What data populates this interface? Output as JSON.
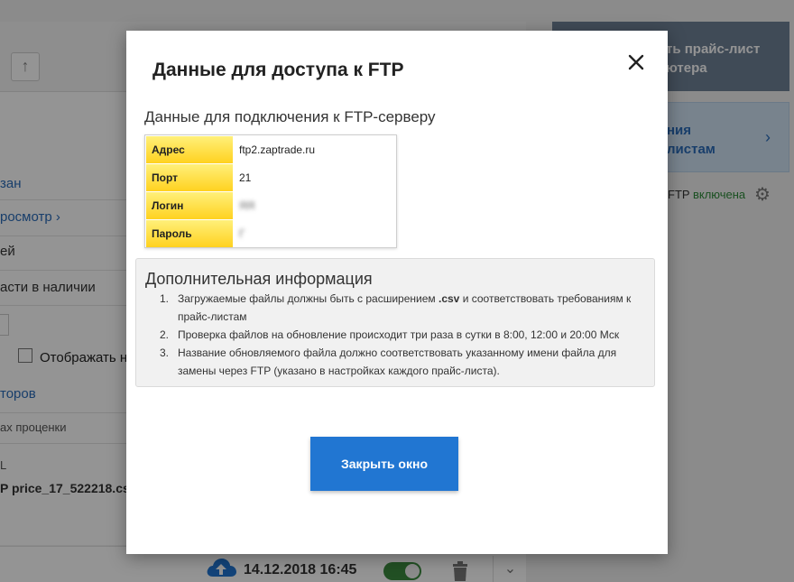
{
  "background": {
    "left_rows": [
      {
        "text": "зан",
        "style": "link"
      },
      {
        "text": "росмотр ›",
        "style": "link"
      },
      {
        "text": "ей",
        "style": "normal"
      },
      {
        "text": "асти в наличии",
        "style": "normal"
      }
    ],
    "checkbox_label": "Отображать н",
    "rows_bottom": [
      {
        "text": "торов",
        "style": "link"
      },
      {
        "text": "ах проценки",
        "style": "small"
      },
      {
        "text": "L",
        "style": "small"
      },
      {
        "text": "P price_17_522218.cs",
        "style": "bold"
      }
    ],
    "right_card1_text": [
      "ть прайс-лист",
      "ютера"
    ],
    "right_card2_text": [
      "ния",
      "листам"
    ],
    "ftp_status_prefix": "FTP",
    "ftp_status_value": "включена",
    "ftp_status_color": "#2e8b3a",
    "last_update": "14.12.2018 16:45",
    "toggle_color": "#3b8a3f"
  },
  "modal": {
    "title": "Данные для доступа к FTP",
    "section_title": "Данные для подключения к FTP-серверу",
    "credentials": [
      {
        "key": "Адрес",
        "value": "ftp2.zaptrade.ru",
        "blurred": false
      },
      {
        "key": "Порт",
        "value": "21",
        "blurred": false
      },
      {
        "key": "Логин",
        "value": "ЯЯ",
        "blurred": true
      },
      {
        "key": "Пароль",
        "value": "Г",
        "blurred": true
      }
    ],
    "info": {
      "title": "Дополнительная информация",
      "items": [
        {
          "num": "1.",
          "before": "Загружаемые файлы должны быть с расширением ",
          "bold": ".csv",
          "after": " и соответствовать требованиям к прайс-листам"
        },
        {
          "num": "2.",
          "before": "Проверка файлов на обновление происходит три раза в сутки в 8:00, 12:00 и 20:00 Мск",
          "bold": "",
          "after": ""
        },
        {
          "num": "3.",
          "before": "Название обновляемого файла должно соответствовать указанному имени файла для замены через FTP (указано в настройках каждого прайс-листа).",
          "bold": "",
          "after": ""
        }
      ]
    },
    "close_button_label": "Закрыть окно",
    "accent_color": "#2176d2",
    "key_cell_color": "#ffd21f"
  }
}
